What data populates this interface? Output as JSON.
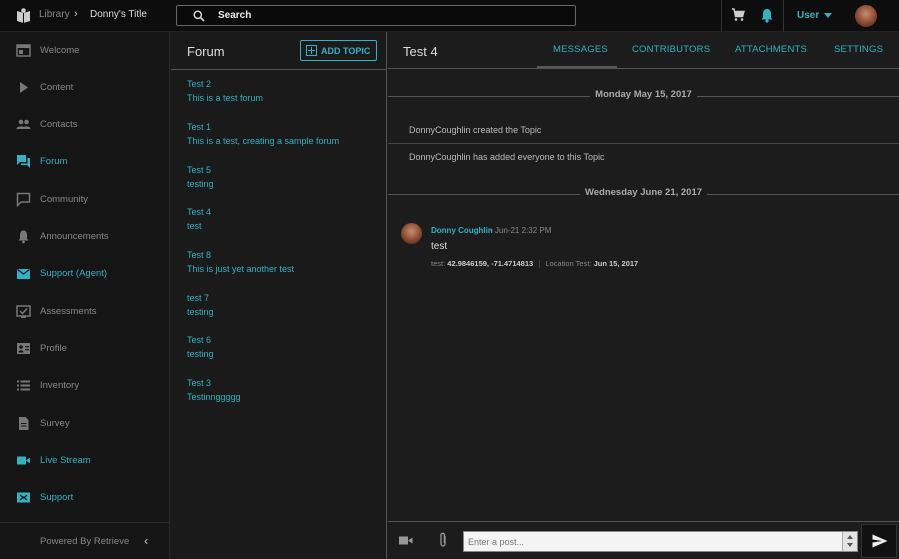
{
  "topbar": {
    "library_label": "Library",
    "breadcrumb_title": "Donny's Title",
    "search_label": "Search",
    "user_label": "User"
  },
  "sidebar": {
    "items": [
      {
        "label": "Welcome",
        "icon": "welcome-icon",
        "highlight": false
      },
      {
        "label": "Content",
        "icon": "play-icon",
        "highlight": false
      },
      {
        "label": "Contacts",
        "icon": "people-icon",
        "highlight": false
      },
      {
        "label": "Forum",
        "icon": "forum-icon",
        "highlight": true
      },
      {
        "label": "Community",
        "icon": "chat-icon",
        "highlight": false
      },
      {
        "label": "Announcements",
        "icon": "bell-icon",
        "highlight": false
      },
      {
        "label": "Support (Agent)",
        "icon": "mail-icon",
        "highlight": true
      },
      {
        "label": "Assessments",
        "icon": "assessment-icon",
        "highlight": false
      },
      {
        "label": "Profile",
        "icon": "profile-icon",
        "highlight": false
      },
      {
        "label": "Inventory",
        "icon": "list-icon",
        "highlight": false
      },
      {
        "label": "Survey",
        "icon": "document-icon",
        "highlight": false
      },
      {
        "label": "Live Stream",
        "icon": "video-icon",
        "highlight": true
      },
      {
        "label": "Support",
        "icon": "support-icon",
        "highlight": true
      }
    ],
    "footer_label": "Powered By Retrieve"
  },
  "forum": {
    "title": "Forum",
    "add_topic_label": "ADD TOPIC",
    "topics": [
      {
        "title": "Test 2",
        "subtitle": "This is a test forum"
      },
      {
        "title": "Test 1",
        "subtitle": "This is a test, creating a sample forum"
      },
      {
        "title": "Test 5",
        "subtitle": "testing"
      },
      {
        "title": "Test 4",
        "subtitle": "test"
      },
      {
        "title": "Test 8",
        "subtitle": "This is just yet another test"
      },
      {
        "title": "test 7",
        "subtitle": "testing"
      },
      {
        "title": "Test 6",
        "subtitle": "testing"
      },
      {
        "title": "Test 3",
        "subtitle": "Testinnggggg"
      }
    ]
  },
  "main": {
    "title": "Test 4",
    "tabs": [
      "MESSAGES",
      "CONTRIBUTORS",
      "ATTACHMENTS",
      "SETTINGS"
    ],
    "date1": "Monday May 15, 2017",
    "system_messages": [
      "DonnyCoughlin created the Topic",
      "DonnyCoughlin has added everyone to this Topic"
    ],
    "date2": "Wednesday June 21, 2017",
    "post": {
      "author": "Donny Coughlin",
      "time": "- Jun-21 2:32 PM",
      "text": "test",
      "meta_label1": "test:",
      "meta_value1": "42.9846159, -71.4714813",
      "meta_sep": "|",
      "meta_label2": "Location Test:",
      "meta_value2": "Jun 15, 2017"
    },
    "composer_placeholder": "Enter a post..."
  },
  "colors": {
    "accent": "#2fb3c4",
    "background": "#1c1c1c",
    "sidebar": "#151515",
    "topbar": "#0d0d0d"
  }
}
